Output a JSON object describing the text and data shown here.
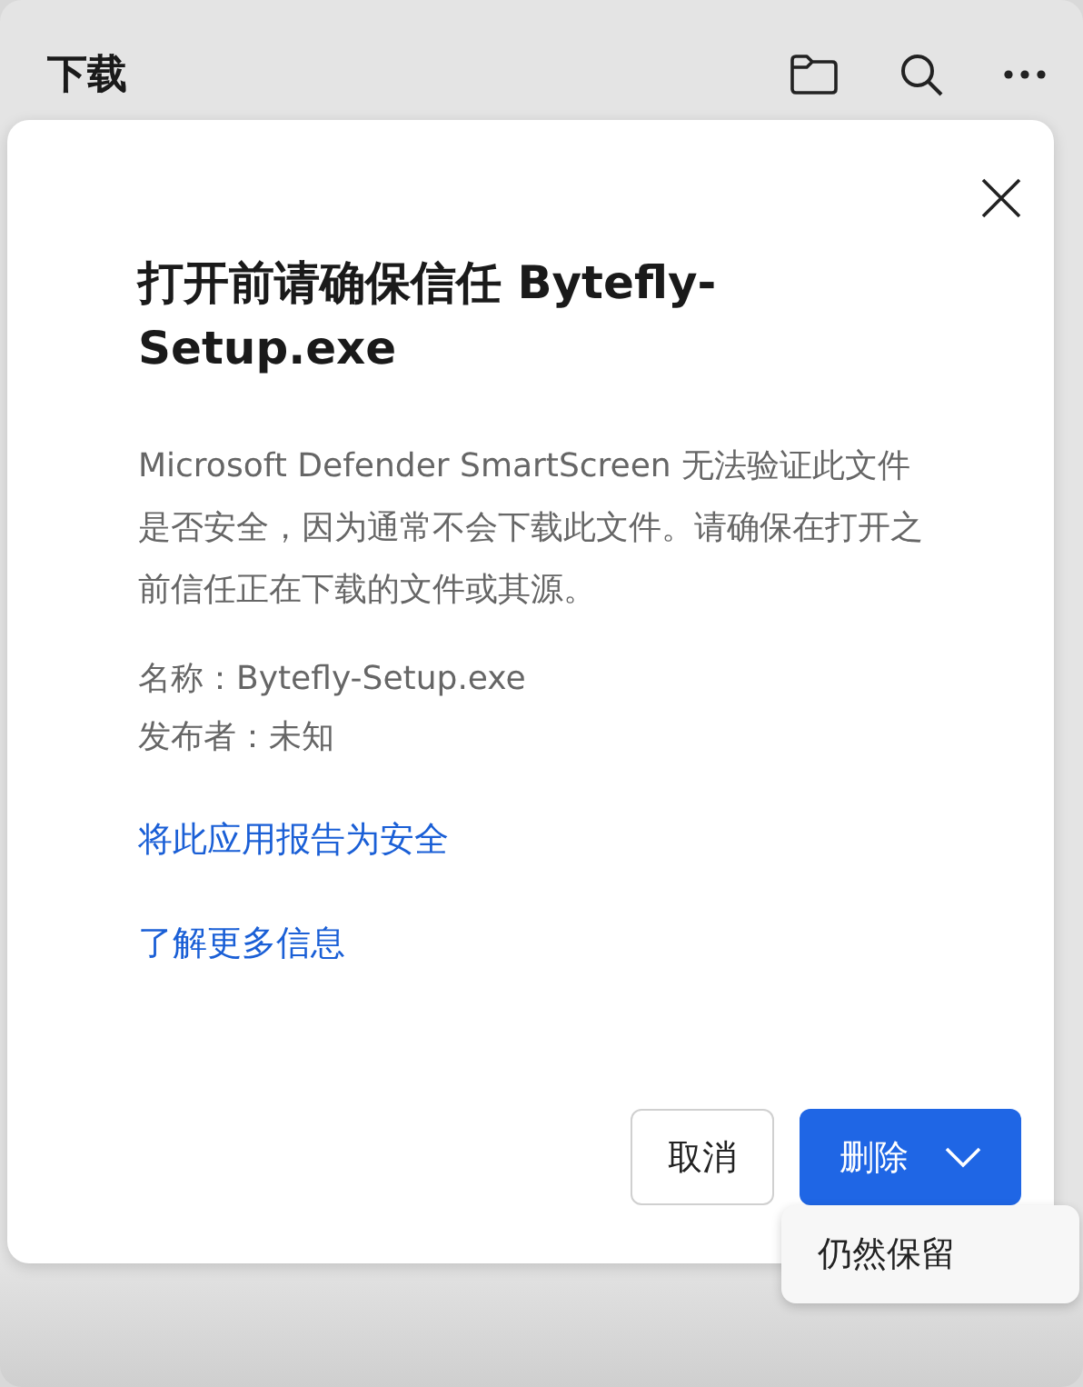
{
  "panel": {
    "title": "下载"
  },
  "dialog": {
    "title": "打开前请确保信任 Bytefly-Setup.exe",
    "message": "Microsoft Defender SmartScreen 无法验证此文件是否安全，因为通常不会下载此文件。请确保在打开之前信任正在下载的文件或其源。",
    "details": [
      "名称：Bytefly-Setup.exe",
      "发布者：未知"
    ],
    "links": [
      "将此应用报告为安全",
      "了解更多信息"
    ],
    "cancel_button": "取消",
    "delete_button": "删除"
  },
  "menu": {
    "items": [
      "仍然保留"
    ]
  }
}
